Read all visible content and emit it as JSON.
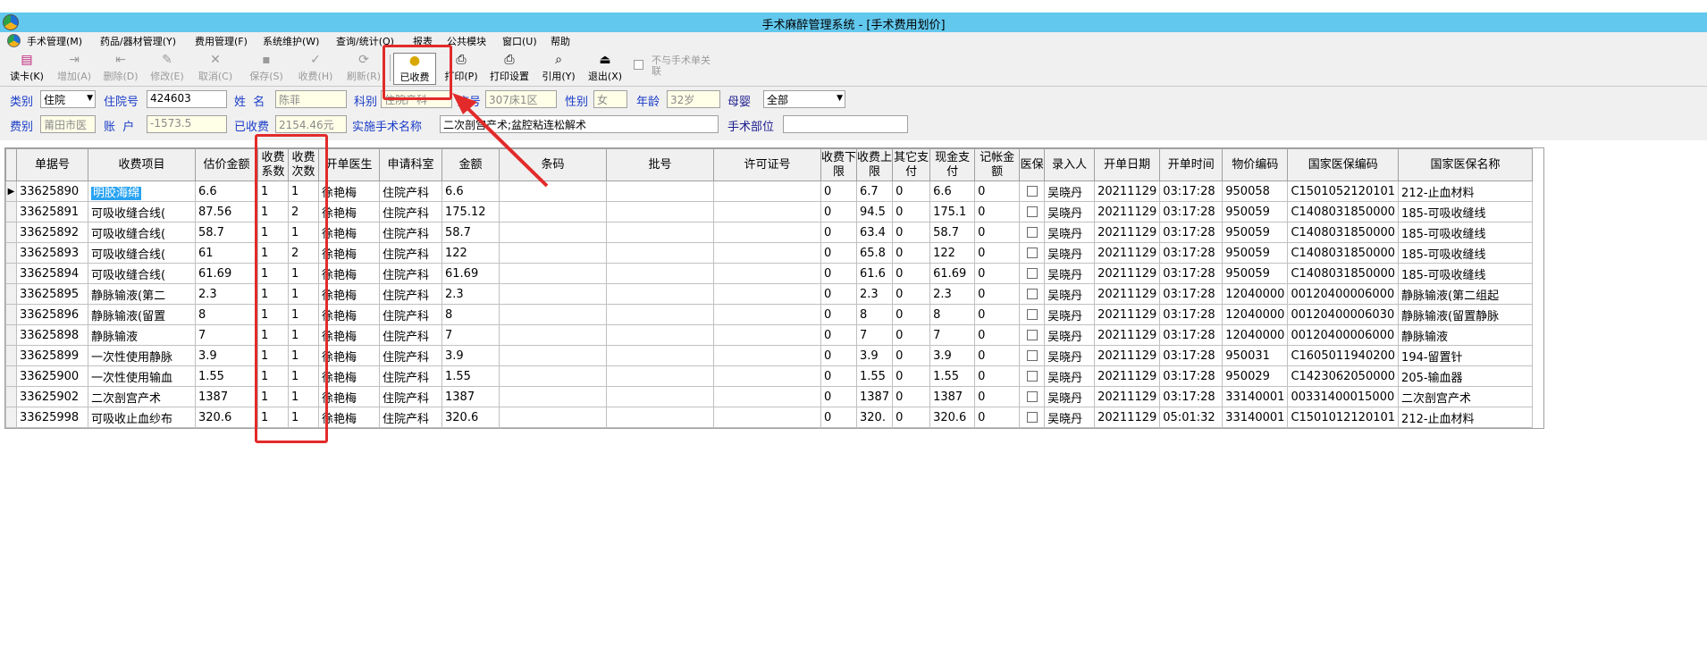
{
  "window": {
    "title": "手术麻醉管理系统 - [手术费用划价]"
  },
  "menu": [
    "手术管理(M)",
    "药品/器材管理(Y)",
    "费用管理(F)",
    "系统维护(W)",
    "查询/统计(Q)",
    "报表",
    "公共模块",
    "窗口(U)",
    "帮助"
  ],
  "toolbar": {
    "read_card": "读卡(K)",
    "add": "增加(A)",
    "delete": "删除(D)",
    "modify": "修改(E)",
    "cancel": "取消(C)",
    "save": "保存(S)",
    "charge": "收费(H)",
    "refresh": "刷新(R)",
    "charged": "已收费",
    "print": "打印(P)",
    "print_settings": "打印设置",
    "cite": "引用(Y)",
    "exit": "退出(X)",
    "unlink": "不与手术单关联"
  },
  "form": {
    "category_label": "类别",
    "category_value": "住院",
    "inpatient_no_label": "住院号",
    "inpatient_no_value": "424603",
    "name_label": "姓  名",
    "name_value": "陈菲",
    "dept_label": "科别",
    "dept_value": "住院产科",
    "bed_label": "床号",
    "bed_value": "307床1区",
    "gender_label": "性别",
    "gender_value": "女",
    "age_label": "年龄",
    "age_value": "32岁",
    "infant_label": "母婴",
    "infant_value": "全部",
    "fee_type_label": "费别",
    "fee_type_value": "莆田市医",
    "account_label": "账  户",
    "account_value": "-1573.5",
    "charged_label": "已收费",
    "charged_value": "2154.46元",
    "surgery_label": "实施手术名称",
    "surgery_value": "二次剖宫产术;盆腔粘连松解术",
    "site_label": "手术部位",
    "site_value": ""
  },
  "table": {
    "columns": [
      "单据号",
      "收费项目",
      "估价金额",
      "收费系数",
      "收费次数",
      "开单医生",
      "申请科室",
      "金额",
      "条码",
      "批号",
      "许可证号",
      "收费下限",
      "收费上限",
      "其它支付",
      "现金支付",
      "记帐金额",
      "医保",
      "录入人",
      "开单日期",
      "开单时间",
      "物价编码",
      "国家医保编码",
      "国家医保名称"
    ],
    "rows": [
      [
        "33625890",
        "明胶海绵",
        "6.6",
        "1",
        "1",
        "徐艳梅",
        "住院产科",
        "6.6",
        "",
        "",
        "",
        "0",
        "6.7",
        "0",
        "6.6",
        "0",
        "",
        "吴晓丹",
        "20211129",
        "03:17:28",
        "950058",
        "C1501052120101",
        "212-止血材料"
      ],
      [
        "33625891",
        "可吸收缝合线(",
        "87.56",
        "1",
        "2",
        "徐艳梅",
        "住院产科",
        "175.12",
        "",
        "",
        "",
        "0",
        "94.5",
        "0",
        "175.1",
        "0",
        "",
        "吴晓丹",
        "20211129",
        "03:17:28",
        "950059",
        "C1408031850000",
        "185-可吸收缝线"
      ],
      [
        "33625892",
        "可吸收缝合线(",
        "58.7",
        "1",
        "1",
        "徐艳梅",
        "住院产科",
        "58.7",
        "",
        "",
        "",
        "0",
        "63.4",
        "0",
        "58.7",
        "0",
        "",
        "吴晓丹",
        "20211129",
        "03:17:28",
        "950059",
        "C1408031850000",
        "185-可吸收缝线"
      ],
      [
        "33625893",
        "可吸收缝合线(",
        "61",
        "1",
        "2",
        "徐艳梅",
        "住院产科",
        "122",
        "",
        "",
        "",
        "0",
        "65.8",
        "0",
        "122",
        "0",
        "",
        "吴晓丹",
        "20211129",
        "03:17:28",
        "950059",
        "C1408031850000",
        "185-可吸收缝线"
      ],
      [
        "33625894",
        "可吸收缝合线(",
        "61.69",
        "1",
        "1",
        "徐艳梅",
        "住院产科",
        "61.69",
        "",
        "",
        "",
        "0",
        "61.6",
        "0",
        "61.69",
        "0",
        "",
        "吴晓丹",
        "20211129",
        "03:17:28",
        "950059",
        "C1408031850000",
        "185-可吸收缝线"
      ],
      [
        "33625895",
        "静脉输液(第二",
        "2.3",
        "1",
        "1",
        "徐艳梅",
        "住院产科",
        "2.3",
        "",
        "",
        "",
        "0",
        "2.3",
        "0",
        "2.3",
        "0",
        "",
        "吴晓丹",
        "20211129",
        "03:17:28",
        "12040000",
        "00120400006000",
        "静脉输液(第二组起"
      ],
      [
        "33625896",
        "静脉输液(留置",
        "8",
        "1",
        "1",
        "徐艳梅",
        "住院产科",
        "8",
        "",
        "",
        "",
        "0",
        "8",
        "0",
        "8",
        "0",
        "",
        "吴晓丹",
        "20211129",
        "03:17:28",
        "12040000",
        "00120400006030",
        "静脉输液(留置静脉"
      ],
      [
        "33625898",
        "静脉输液",
        "7",
        "1",
        "1",
        "徐艳梅",
        "住院产科",
        "7",
        "",
        "",
        "",
        "0",
        "7",
        "0",
        "7",
        "0",
        "",
        "吴晓丹",
        "20211129",
        "03:17:28",
        "12040000",
        "00120400006000",
        "静脉输液"
      ],
      [
        "33625899",
        "一次性使用静脉",
        "3.9",
        "1",
        "1",
        "徐艳梅",
        "住院产科",
        "3.9",
        "",
        "",
        "",
        "0",
        "3.9",
        "0",
        "3.9",
        "0",
        "",
        "吴晓丹",
        "20211129",
        "03:17:28",
        "950031",
        "C1605011940200",
        "194-留置针"
      ],
      [
        "33625900",
        "一次性使用输血",
        "1.55",
        "1",
        "1",
        "徐艳梅",
        "住院产科",
        "1.55",
        "",
        "",
        "",
        "0",
        "1.55",
        "0",
        "1.55",
        "0",
        "",
        "吴晓丹",
        "20211129",
        "03:17:28",
        "950029",
        "C1423062050000",
        "205-输血器"
      ],
      [
        "33625902",
        "二次剖宫产术",
        "1387",
        "1",
        "1",
        "徐艳梅",
        "住院产科",
        "1387",
        "",
        "",
        "",
        "0",
        "1387",
        "0",
        "1387",
        "0",
        "",
        "吴晓丹",
        "20211129",
        "03:17:28",
        "33140001",
        "00331400015000",
        "二次剖宫产术"
      ],
      [
        "33625998",
        "可吸收止血纱布",
        "320.6",
        "1",
        "1",
        "徐艳梅",
        "住院产科",
        "320.6",
        "",
        "",
        "",
        "0",
        "320.",
        "0",
        "320.6",
        "0",
        "",
        "吴晓丹",
        "20211129",
        "05:01:32",
        "33140001",
        "C1501012120101",
        "212-止血材料"
      ]
    ]
  },
  "colors": {
    "titlebar": "#62c8ee",
    "highlight": "#e22a2a",
    "label": "#1a3cc8",
    "selected": "#29a3f2"
  }
}
